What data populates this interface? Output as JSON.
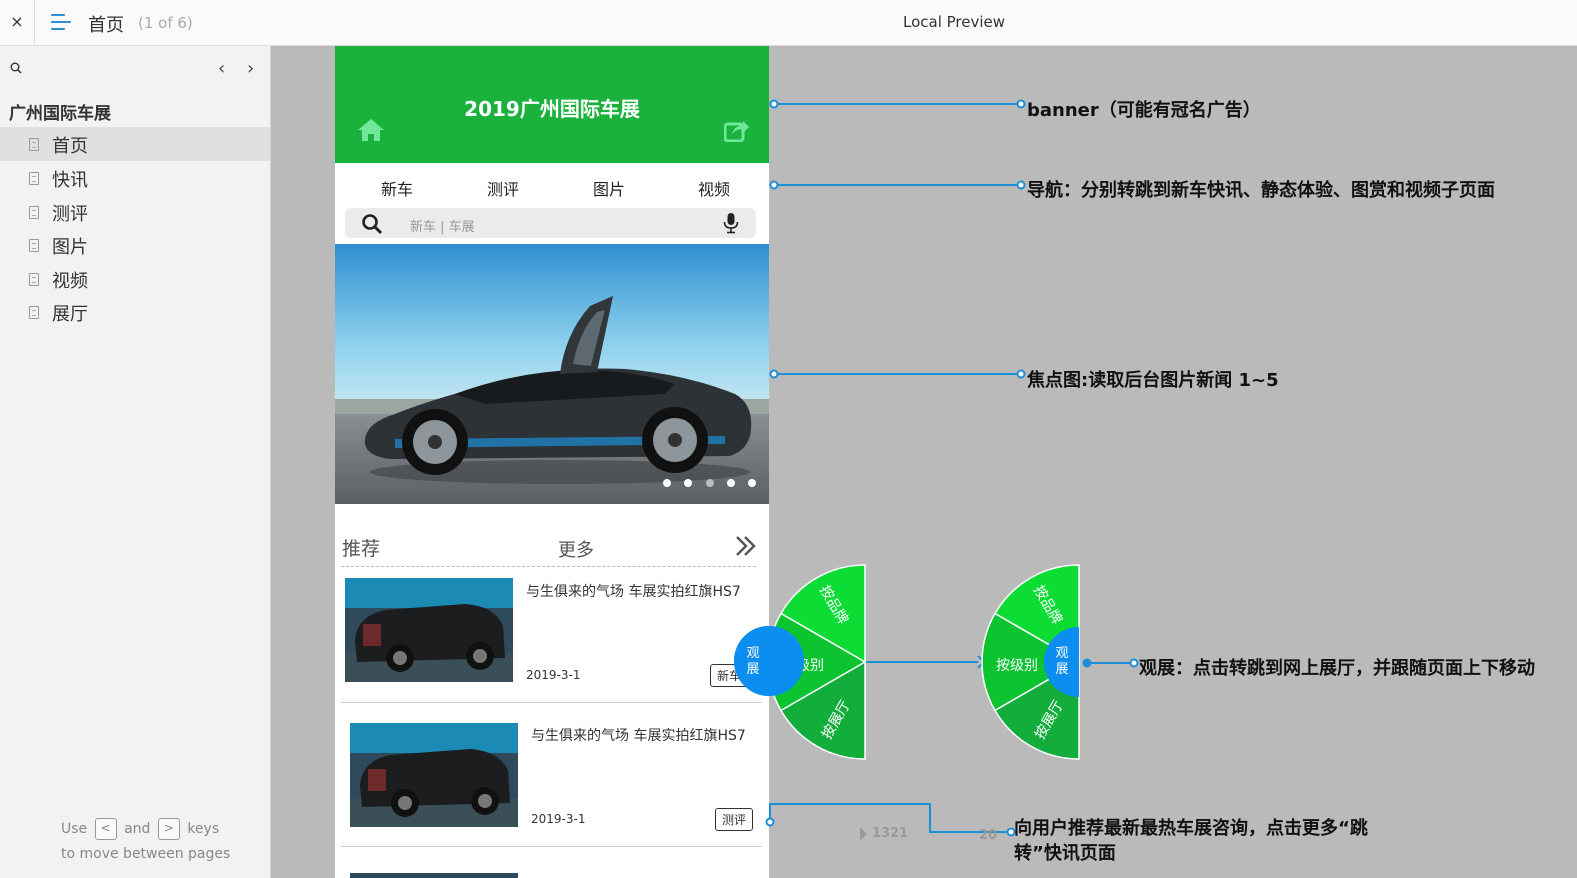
{
  "topbar": {
    "close_glyph": "×",
    "page_title": "首页",
    "page_count": "(1 of 6)",
    "preview_title": "Local Preview"
  },
  "sidebar": {
    "prev_glyph": "‹",
    "next_glyph": "›",
    "project_name": "广州国际车展",
    "pages": [
      {
        "label": "首页",
        "active": true
      },
      {
        "label": "快讯",
        "active": false
      },
      {
        "label": "测评",
        "active": false
      },
      {
        "label": "图片",
        "active": false
      },
      {
        "label": "视频",
        "active": false
      },
      {
        "label": "展厅",
        "active": false
      }
    ],
    "hint": {
      "use": "Use",
      "key_prev": "<",
      "and": "and",
      "key_next": ">",
      "keys": "keys",
      "line2": "to move between pages"
    }
  },
  "phone": {
    "banner_title": "2019广州国际车展",
    "banner_color": "#1ab23c",
    "tabs": [
      "新车",
      "测评",
      "图片",
      "视频"
    ],
    "search_placeholder": "新车 | 车展",
    "carousel_dots": 5,
    "carousel_active_dot": 3,
    "recommend_label": "推荐",
    "more_label": "更多",
    "news": [
      {
        "title": "与生俱来的气场 车展实拍红旗HS7",
        "date": "2019-3-1",
        "tag": "新车"
      },
      {
        "title": "与生俱来的气场 车展实拍红旗HS7",
        "date": "2019-3-1",
        "tag": "测评"
      }
    ]
  },
  "float_menu": {
    "center_label_1": "观",
    "center_label_2": "展",
    "items": [
      "按品牌",
      "按级别",
      "按展厅"
    ]
  },
  "annotations": {
    "banner": "banner（可能有冠名广告）",
    "nav": "导航：分别转跳到新车快讯、静态体验、图赏和视频子页面",
    "focus": "焦点图:读取后台图片新闻 1~5",
    "float": "观展：点击转跳到网上展厅，并跟随页面上下移动",
    "recommend_line1": "向用户推荐最新最热车展咨询，点击更多“跳",
    "recommend_line2": "转”快讯页面",
    "ghost_number": "1321",
    "ghost_number2": "20"
  },
  "colors": {
    "connector": "#1d8fd6",
    "wedge_light": "#0ddc35",
    "wedge_mid": "#0bc430",
    "wedge_dark": "#12ad3a",
    "center_blue": "#0b8ef0"
  }
}
